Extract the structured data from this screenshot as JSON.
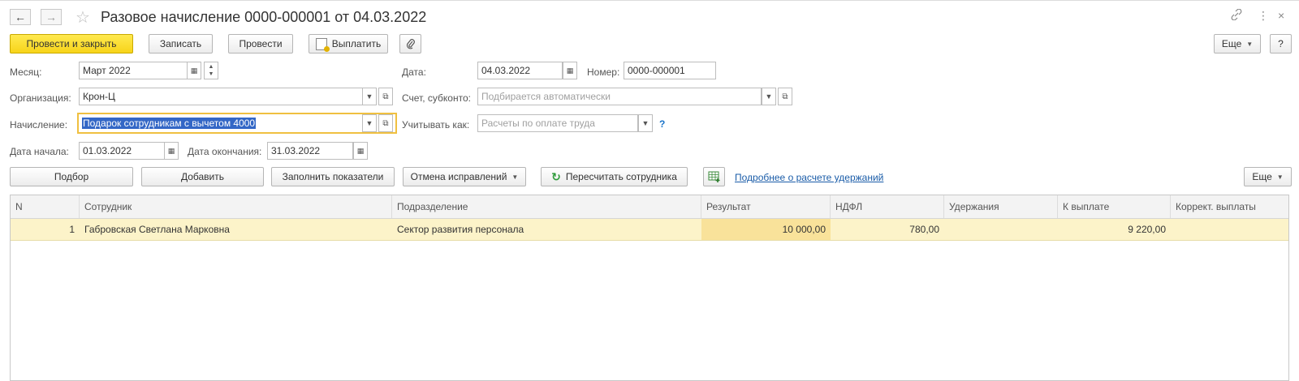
{
  "window": {
    "title": "Разовое начисление 0000-000001 от 04.03.2022",
    "back_glyph": "←",
    "forward_glyph": "→",
    "star_glyph": "☆",
    "link_glyph": "🔗",
    "more_glyph": "⋮",
    "close_glyph": "×"
  },
  "toolbar": {
    "post_close": "Провести и закрыть",
    "save": "Записать",
    "post": "Провести",
    "pay": "Выплатить",
    "more": "Еще",
    "help": "?"
  },
  "form": {
    "month_label": "Месяц:",
    "month_value": "Март 2022",
    "date_label": "Дата:",
    "date_value": "04.03.2022",
    "number_label": "Номер:",
    "number_value": "0000-000001",
    "org_label": "Организация:",
    "org_value": "Крон-Ц",
    "account_label": "Счет, субконто:",
    "account_placeholder": "Подбирается автоматически",
    "accrual_label": "Начисление:",
    "accrual_value": "Подарок сотрудникам с вычетом 4000",
    "consider_label": "Учитывать как:",
    "consider_placeholder": "Расчеты по оплате труда",
    "consider_help": "?",
    "start_label": "Дата начала:",
    "start_value": "01.03.2022",
    "end_label": "Дата окончания:",
    "end_value": "31.03.2022"
  },
  "table_toolbar": {
    "select": "Подбор",
    "add": "Добавить",
    "fill": "Заполнить показатели",
    "cancel_fix": "Отмена исправлений",
    "recalc": "Пересчитать сотрудника",
    "details_link": "Подробнее о расчете удержаний",
    "more": "Еще"
  },
  "table": {
    "columns": [
      "N",
      "Сотрудник",
      "Подразделение",
      "Результат",
      "НДФЛ",
      "Удержания",
      "К выплате",
      "Коррект. выплаты"
    ],
    "rows": [
      {
        "n": "1",
        "employee": "Габровская Светлана Марковна",
        "department": "Сектор развития персонала",
        "result": "10 000,00",
        "ndfl": "780,00",
        "deductions": "",
        "to_pay": "9 220,00",
        "correction": ""
      }
    ]
  },
  "colors": {
    "primary_button": "#f7d41a",
    "selected_row": "#fcf3c9",
    "highlight_cell": "#f9e29a",
    "link": "#1a5ca8",
    "focus_border": "#f0c040"
  }
}
